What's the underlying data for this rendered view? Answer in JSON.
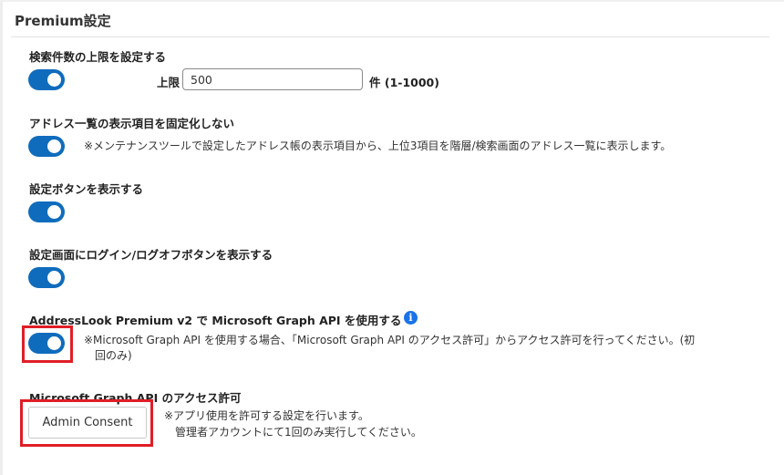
{
  "page": {
    "title": "Premium設定"
  },
  "settings": {
    "search_limit": {
      "label": "検索件数の上限を設定する",
      "enabled": true,
      "limit_label": "上限",
      "value": "500",
      "unit_text": "件 (1-1000)"
    },
    "address_list": {
      "label": "アドレス一覧の表示項目を固定化しない",
      "enabled": true,
      "note": "※メンテナンスツールで設定したアドレス帳の表示項目から、上位3項目を階層/検索画面のアドレス一覧に表示します。"
    },
    "settings_button": {
      "label": "設定ボタンを表示する",
      "enabled": true
    },
    "login_button": {
      "label": "設定画面にログイン/ログオフボタンを表示する",
      "enabled": true
    },
    "graph_api": {
      "label": "AddressLook Premium v2 で Microsoft Graph API を使用する",
      "enabled": true,
      "info_icon": "i",
      "note_line1": "※Microsoft Graph API を使用する場合、「Microsoft Graph API のアクセス許可」からアクセス許可を行ってください。(初",
      "note_line2": "回のみ)"
    },
    "graph_access": {
      "label": "Microsoft Graph API のアクセス許可",
      "button_label": "Admin Consent",
      "note_line1": "※アプリ使用を許可する設定を行います。",
      "note_line2": "管理者アカウントにて1回のみ実行してください。"
    }
  },
  "colors": {
    "toggle_on": "#0f6cbd",
    "highlight": "#e01e26",
    "info": "#1a73e8"
  }
}
